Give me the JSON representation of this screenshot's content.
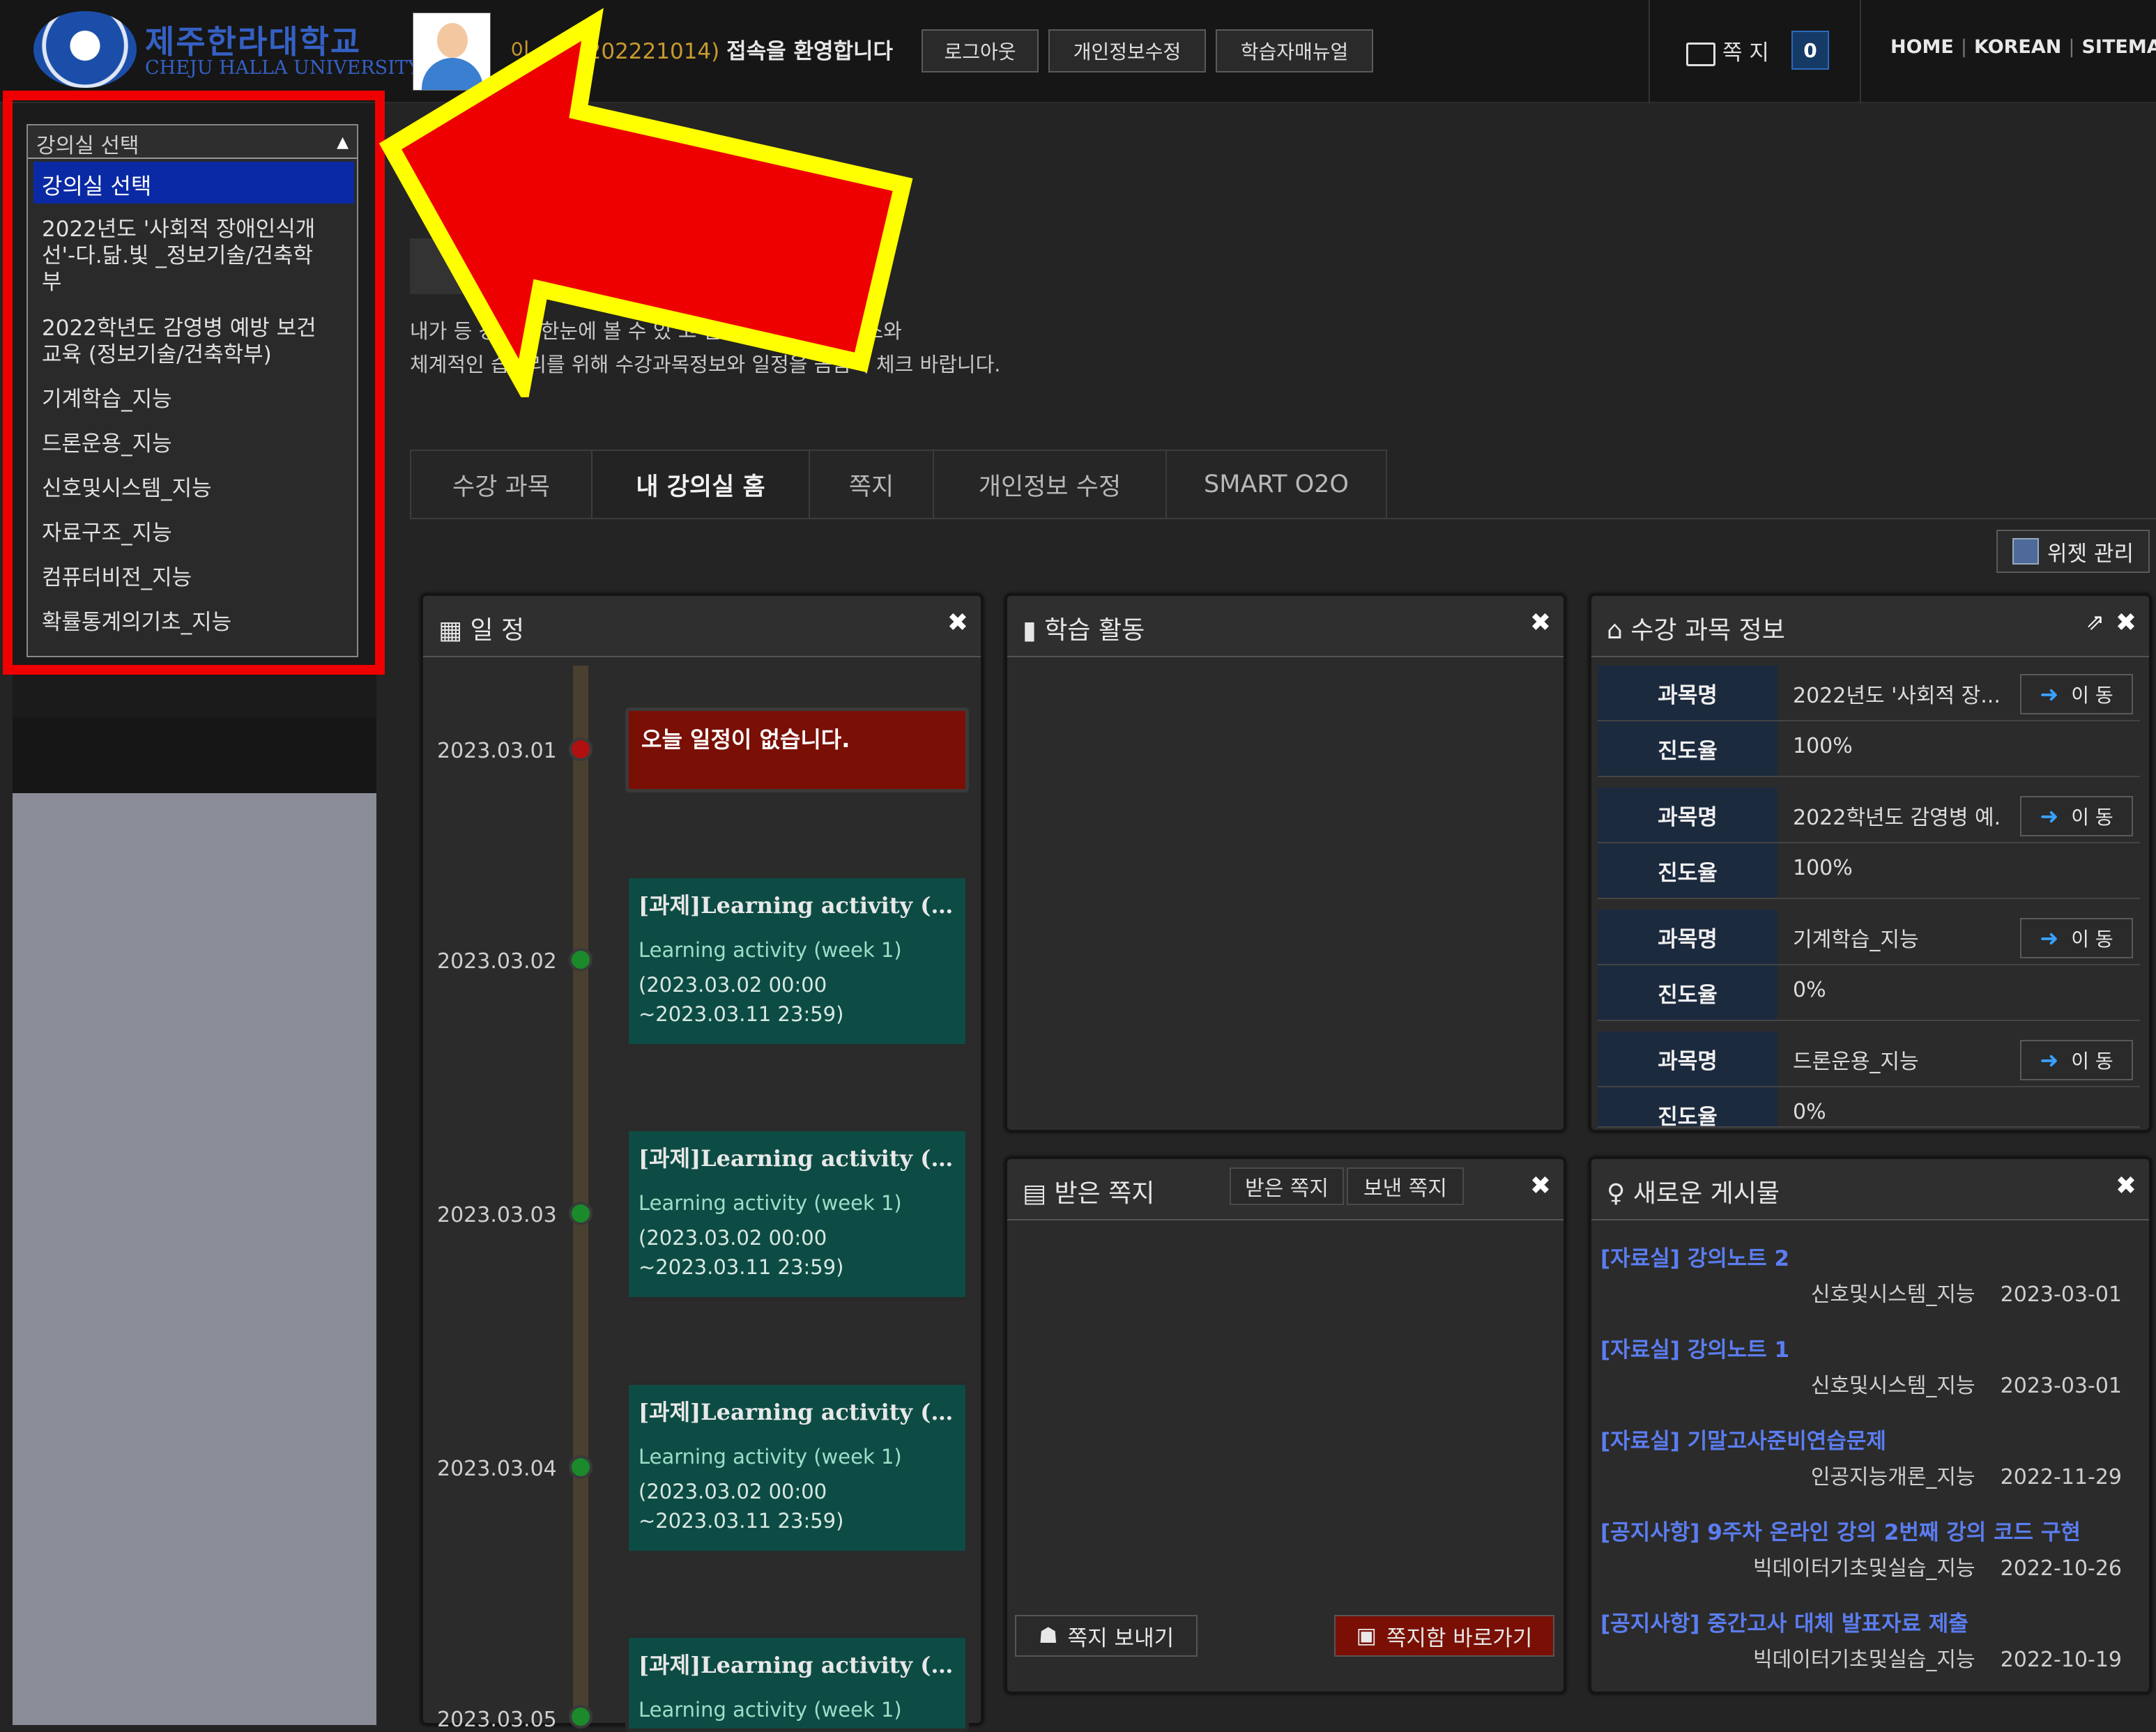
{
  "header": {
    "logo": {
      "korean": "제주한라대학교",
      "english": "CHEJU HALLA UNIVERSITY"
    },
    "user_name": "이",
    "user_id": "(202221014)",
    "welcome_text": "접속을 환영합니다",
    "buttons": [
      "로그아웃",
      "개인정보수정",
      "학습자매뉴얼"
    ],
    "messages_label": "쪽 지",
    "messages_count": "0",
    "links": [
      "HOME",
      "KOREAN",
      "SITEMAP"
    ]
  },
  "intro": {
    "line1": "내가 등        강의를 한눈에 볼 수 있                고 안정적인 교육 서비스와",
    "line2": "체계적인      습관리를 위해 수강과목정보와 일정을 꼼꼼히 체크 바랍니다."
  },
  "tabs": [
    "수강 과목",
    "내 강의실 홈",
    "쪽지",
    "개인정보 수정",
    "SMART O2O"
  ],
  "active_tab_index": 1,
  "widget_manage": "위젯 관리",
  "schedule": {
    "title": "일 정",
    "empty_msg": "오늘 일정이 없습니다.",
    "dates": [
      "2023.03.01",
      "2023.03.02",
      "2023.03.03",
      "2023.03.04",
      "2023.03.05"
    ],
    "item_title": "[과제]Learning activity (wee...",
    "item_sub": "Learning activity (week 1)",
    "item_period": "(2023.03.02 00:00 ~2023.03.11 23:59)",
    "colors": {
      "today": "#b01010",
      "item": "#1a8a2a"
    }
  },
  "activity": {
    "title": "학습 활동"
  },
  "course_info": {
    "title": "수강 과목 정보",
    "key_name": "과목명",
    "key_progress": "진도율",
    "move_label": "이 동",
    "courses": [
      {
        "name": "2022년도 '사회적 장...",
        "progress": "100%"
      },
      {
        "name": "2022학년도 감영병 예...",
        "progress": "100%"
      },
      {
        "name": "기계학습_지능",
        "progress": "0%"
      },
      {
        "name": "드론운용_지능",
        "progress": "0%"
      }
    ]
  },
  "inbox": {
    "title": "받은 쪽지",
    "tabs": [
      "받은 쪽지",
      "보낸 쪽지"
    ],
    "send_btn": "쪽지 보내기",
    "goto_btn": "쪽지함 바로가기"
  },
  "posts": {
    "title": "새로운 게시물",
    "items": [
      {
        "title": "[자료실] 강의노트 2",
        "course": "신호및시스템_지능",
        "date": "2023-03-01"
      },
      {
        "title": "[자료실] 강의노트 1",
        "course": "신호및시스템_지능",
        "date": "2023-03-01"
      },
      {
        "title": "[자료실] 기말고사준비연습문제",
        "course": "인공지능개론_지능",
        "date": "2022-11-29"
      },
      {
        "title": "[공지사항] 9주차 온라인 강의 2번째 강의 코드 구현",
        "course": "빅데이터기초및실습_지능",
        "date": "2022-10-26"
      },
      {
        "title": "[공지사항] 중간고사 대체 발표자료 제출",
        "course": "빅데이터기초및실습_지능",
        "date": "2022-10-19"
      }
    ]
  },
  "dropdown": {
    "header": "강의실 선택",
    "selected": "강의실 선택",
    "options": [
      "2022년도 '사회적 장애인식개선'-다.닮.빛 _정보기술/건축학부",
      "2022학년도 감영병 예방 보건교육 (정보기술/건축학부)",
      "기계학습_지능",
      "드론운용_지능",
      "신호및시스템_지능",
      "자료구조_지능",
      "컴퓨터비전_지능",
      "확률통계의기초_지능"
    ]
  },
  "annotation_colors": {
    "box": "#ee0000",
    "arrow_fill": "#ee0000",
    "arrow_stroke": "#ffff00"
  }
}
